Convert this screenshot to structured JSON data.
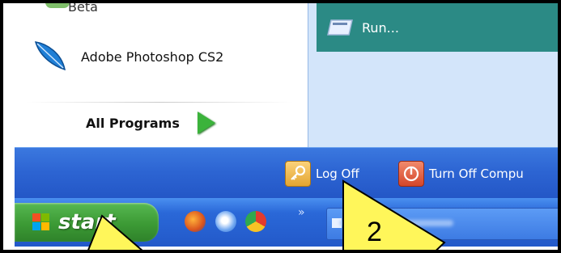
{
  "start_menu": {
    "left_items": [
      {
        "label": "Beta",
        "icon": "app-icon"
      },
      {
        "label": "Adobe Photoshop CS2",
        "icon": "photoshop-feather-icon"
      }
    ],
    "all_programs_label": "All Programs",
    "right_items": [
      {
        "label": "Run...",
        "icon": "run-icon"
      }
    ],
    "bottom_bar": {
      "log_off_label": "Log Off",
      "turn_off_label": "Turn Off Compu"
    }
  },
  "taskbar": {
    "start_label": "start",
    "quick_launch": [
      "firefox-icon",
      "internet-explorer-icon",
      "chrome-icon"
    ],
    "overflow_label": "»"
  },
  "annotations": {
    "callout_2_label": "2"
  },
  "colors": {
    "selection": "#2b8a85",
    "start_button": "#3c9a35",
    "taskbar_blue": "#2359c9",
    "callout_yellow": "#fff65a"
  }
}
